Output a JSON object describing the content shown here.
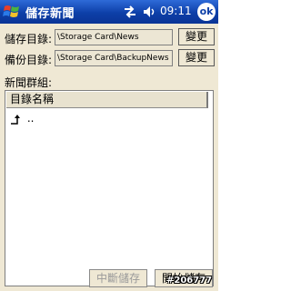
{
  "titlebar": {
    "title": "儲存新聞",
    "time": "09:11",
    "ok_label": "ok"
  },
  "storage": {
    "label": "儲存目錄:",
    "path": "\\Storage Card\\News",
    "change_label": "變更"
  },
  "backup": {
    "label": "備份目錄:",
    "path": "\\Storage Card\\BackupNews",
    "change_label": "變更"
  },
  "group": {
    "label": "新聞群組:",
    "column_header": "目錄名稱",
    "items": [
      {
        "label": ".."
      }
    ]
  },
  "buttons": {
    "stop_label": "中斷儲存",
    "start_label": "開始儲存"
  },
  "watermark": "#206777",
  "colors": {
    "titlebar": "#0d3fa8",
    "background": "#efe8d4",
    "list_background": "#ffffff"
  }
}
